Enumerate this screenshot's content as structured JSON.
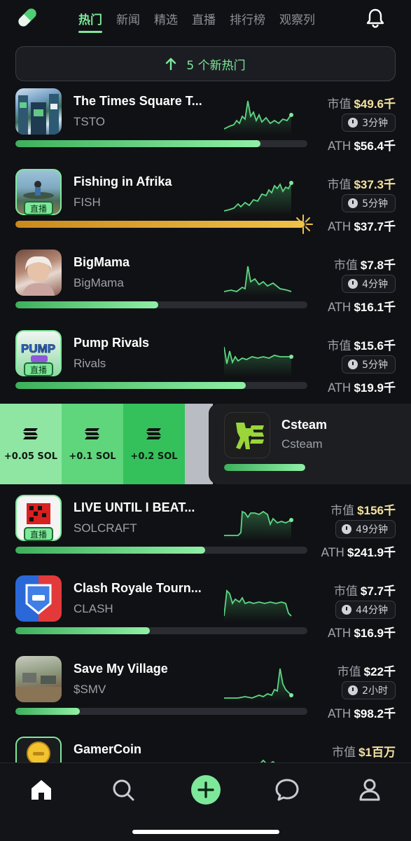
{
  "header": {
    "tabs": [
      "热门",
      "新闻",
      "精选",
      "直播",
      "排行榜",
      "观察列"
    ],
    "active_tab": 0
  },
  "banner": {
    "label": "5 个新热门"
  },
  "labels": {
    "market_cap": "市值",
    "ath": "ATH",
    "live": "直播"
  },
  "tokens": [
    {
      "name": "The Times Square T...",
      "ticker": "TSTO",
      "market_cap": "$49.6千",
      "mc_highlight": true,
      "age": "3分钟",
      "ath": "$56.4千",
      "progress": 0.84,
      "live": false
    },
    {
      "name": "Fishing in Afrika",
      "ticker": "FISH",
      "market_cap": "$37.3千",
      "mc_highlight": true,
      "age": "5分钟",
      "ath": "$37.7千",
      "progress": 0.99,
      "live": true
    },
    {
      "name": "BigMama",
      "ticker": "BigMama",
      "market_cap": "$7.8千",
      "mc_highlight": false,
      "age": "4分钟",
      "ath": "$16.1千",
      "progress": 0.49,
      "live": false
    },
    {
      "name": "Pump Rivals",
      "ticker": "Rivals",
      "market_cap": "$15.6千",
      "mc_highlight": false,
      "age": "5分钟",
      "ath": "$19.9千",
      "progress": 0.79,
      "live": true
    },
    {
      "name": "LIVE UNTIL I BEAT...",
      "ticker": "SOLCRAFT",
      "market_cap": "$156千",
      "mc_highlight": true,
      "age": "49分钟",
      "ath": "$241.9千",
      "progress": 0.65,
      "live": true
    },
    {
      "name": "Clash Royale Tourn...",
      "ticker": "CLASH",
      "market_cap": "$7.7千",
      "mc_highlight": false,
      "age": "44分钟",
      "ath": "$16.9千",
      "progress": 0.46,
      "live": false
    },
    {
      "name": "Save My Village",
      "ticker": "$SMV",
      "market_cap": "$22千",
      "mc_highlight": false,
      "age": "2小时",
      "ath": "$98.2千",
      "progress": 0.22,
      "live": false
    },
    {
      "name": "GamerCoin",
      "ticker": "",
      "market_cap": "$1百万",
      "mc_highlight": true,
      "age": "",
      "ath": "",
      "progress": 0,
      "live": true
    }
  ],
  "swipe_row": {
    "buttons": [
      "+0.05 SOL",
      "+0.1 SOL",
      "+0.2 SOL"
    ],
    "name": "Csteam",
    "ticker": "Csteam",
    "progress": 0.4
  },
  "colors": {
    "accent": "#7ee89a",
    "gold": "#f0c24a",
    "background": "#101114"
  }
}
